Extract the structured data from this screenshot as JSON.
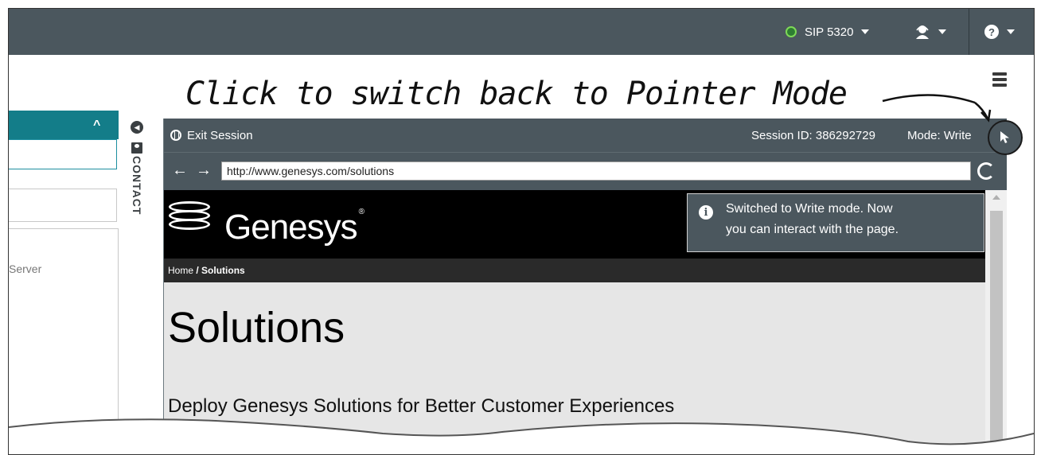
{
  "topbar": {
    "sip_label": "SIP 5320",
    "status_color": "#2e7d32",
    "agent_icon": "agent-headset-icon",
    "help_icon": "help-icon",
    "help_glyph": "?"
  },
  "annotation": {
    "text": "Click to switch back to Pointer Mode"
  },
  "left_panel": {
    "header_chevron": "^",
    "server_text": "Server"
  },
  "contact": {
    "label": "CONTACT"
  },
  "session": {
    "exit_label": "Exit Session",
    "session_id_text": "Session ID: 386292729",
    "mode_text": "Mode: Write",
    "pointer_icon": "pointer-mode-icon"
  },
  "address_bar": {
    "back_glyph": "←",
    "forward_glyph": "→",
    "url": "http://www.genesys.com/solutions"
  },
  "page": {
    "brand": "Genesys",
    "brand_mark": "®",
    "breadcrumb_home": "Home",
    "breadcrumb_sep": " / ",
    "breadcrumb_current": "Solutions",
    "heading": "Solutions",
    "subheading": "Deploy Genesys Solutions for Better Customer Experiences"
  },
  "toast": {
    "info_glyph": "i",
    "line1": "Switched to Write mode. Now",
    "line2": "you can interact with the page."
  }
}
